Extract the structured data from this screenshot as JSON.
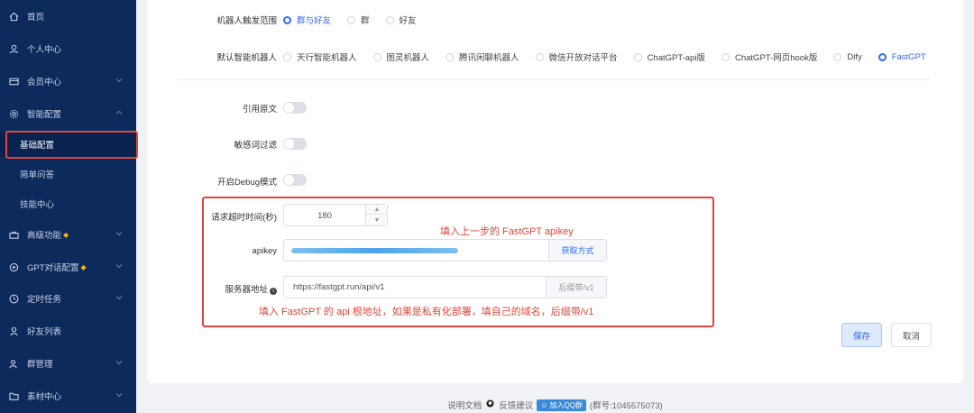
{
  "sidebar": {
    "items": [
      {
        "label": "首页",
        "icon": "home-icon"
      },
      {
        "label": "个人中心",
        "icon": "user-icon"
      },
      {
        "label": "会员中心",
        "icon": "card-icon"
      },
      {
        "label": "智能配置",
        "icon": "gear-icon"
      },
      {
        "label": "基础配置"
      },
      {
        "label": "简单问答"
      },
      {
        "label": "技能中心"
      },
      {
        "label": "高级功能",
        "icon": "briefcase-icon"
      },
      {
        "label": "GPT对话配置",
        "icon": "gpt-icon"
      },
      {
        "label": "定时任务",
        "icon": "clock-icon"
      },
      {
        "label": "好友列表",
        "icon": "person-icon"
      },
      {
        "label": "群管理",
        "icon": "group-icon"
      },
      {
        "label": "素材中心",
        "icon": "folder-icon"
      }
    ]
  },
  "form": {
    "trigger_label": "机器人触发范围",
    "trigger_options": [
      "群与好友",
      "群",
      "好友"
    ],
    "robot_label": "默认智能机器人",
    "robot_options": [
      "天行智能机器人",
      "图灵机器人",
      "腾讯闲聊机器人",
      "微信开放对话平台",
      "ChatGPT-api版",
      "ChatGPT-网页hook版",
      "Dify",
      "FastGPT"
    ],
    "quote_label": "引用原文",
    "sensitive_label": "敏感词过滤",
    "debug_label": "开启Debug模式",
    "timeout_label": "请求超时时间(秒)",
    "timeout_value": "180",
    "apikey_label": "apikey",
    "apikey_append": "获取方式",
    "server_label": "服务器地址",
    "server_value": "https://fastgpt.run/api/v1",
    "server_append": "后缀带/v1",
    "save": "保存",
    "cancel": "取消"
  },
  "annotations": {
    "apikey_note": "填入上一步的 FastGPT apikey",
    "server_note": "填入 FastGPT 的 api 根地址，如果是私有化部署，填自己的域名，后缀带/v1"
  },
  "footer": {
    "docs": "说明文档",
    "feedback": "反馈建议",
    "qq": "加入QQ群",
    "group": "(群号:1045575073)"
  },
  "colors": {
    "sidebar": "#0d2a5c",
    "accent": "#2f6bf3",
    "annotation": "#e2463a"
  }
}
